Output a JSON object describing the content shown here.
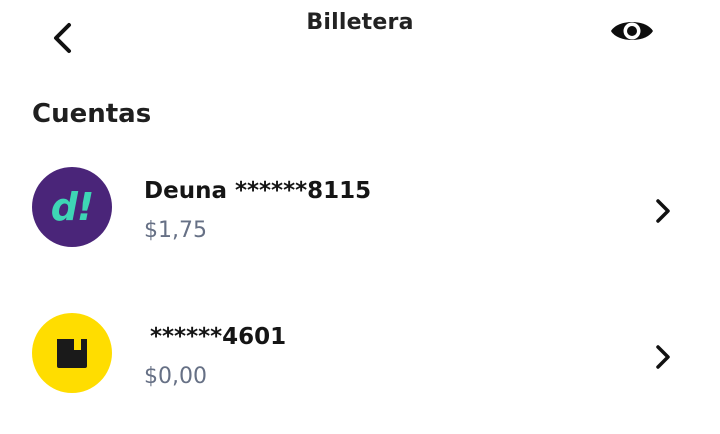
{
  "header": {
    "title": "Billetera",
    "back_icon": "chevron-left-icon",
    "visibility_icon": "eye-icon"
  },
  "accounts_section": {
    "title": "Cuentas",
    "items": [
      {
        "name": "Deuna ******8115",
        "balance": "$1,75",
        "logo_text": "d!",
        "logo_bg": "#4a2579",
        "logo_fg": "#3ed6b5",
        "chevron_icon": "chevron-right-icon"
      },
      {
        "name": "******4601",
        "balance": "$0,00",
        "logo_icon": "bank-logo-icon",
        "logo_bg": "#ffdd00",
        "logo_fg": "#1a1a1a",
        "chevron_icon": "chevron-right-icon"
      }
    ]
  },
  "colors": {
    "text_primary": "#151515",
    "text_secondary": "#667085",
    "background": "#ffffff"
  }
}
